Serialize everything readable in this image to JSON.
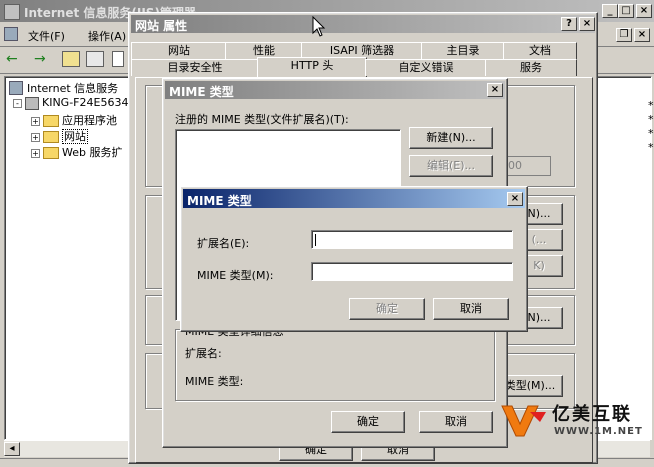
{
  "mmc": {
    "title": "Internet 信息服务(IIS)管理器",
    "menu": [
      "文件(F)",
      "操作(A)"
    ],
    "tree": {
      "root": "Internet 信息服务",
      "server": "KING-F24E5634",
      "items": [
        "应用程序池",
        "网站",
        "Web 服务扩"
      ]
    },
    "right_marks": [
      "*",
      "*",
      "*",
      "*"
    ]
  },
  "props": {
    "title": "网站 属性",
    "help_btn": "?",
    "close_btn": "×",
    "tabs_row1": [
      "网站",
      "性能",
      "ISAPI 筛选器",
      "主目录",
      "文档"
    ],
    "tabs_row2": [
      "目录安全性",
      "HTTP 头",
      "自定义错误",
      "服务"
    ],
    "bg_buttons": [
      "N)...",
      "(...",
      "K)",
      "N)...",
      "类型(M)..."
    ],
    "bg_spin": "00",
    "bottom_buttons": [
      "确定",
      "取消"
    ]
  },
  "mime_list": {
    "title": "MIME 类型",
    "close_btn": "×",
    "registered_label": "注册的 MIME 类型(文件扩展名)(T):",
    "new_btn": "新建(N)...",
    "edit_btn": "编辑(E)...",
    "detail_group": "MIME 类型详细信息",
    "ext_label": "扩展名:",
    "mime_label": "MIME 类型:",
    "ok_btn": "确定",
    "cancel_btn": "取消"
  },
  "mime_dialog": {
    "title": "MIME 类型",
    "close_btn": "×",
    "ext_label": "扩展名(E):",
    "ext_value": "",
    "mime_label": "MIME 类型(M):",
    "mime_value": "",
    "ok_btn": "确定",
    "cancel_btn": "取消"
  },
  "watermark": {
    "brand": "亿美互联",
    "url": "WWW.1M.NET"
  }
}
